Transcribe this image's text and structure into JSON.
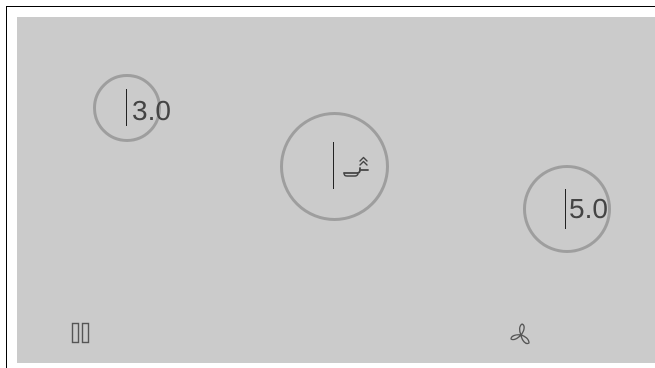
{
  "zones": {
    "left": {
      "value": "3.0"
    },
    "center": {
      "icon": "boost-pan-icon"
    },
    "right": {
      "value": "5.0"
    }
  },
  "controls": {
    "pause": {
      "icon": "pause-icon"
    },
    "fan": {
      "icon": "fan-icon"
    }
  },
  "colors": {
    "panel": "#cbcbcb",
    "ring": "#9e9e9e",
    "text": "#444444"
  }
}
